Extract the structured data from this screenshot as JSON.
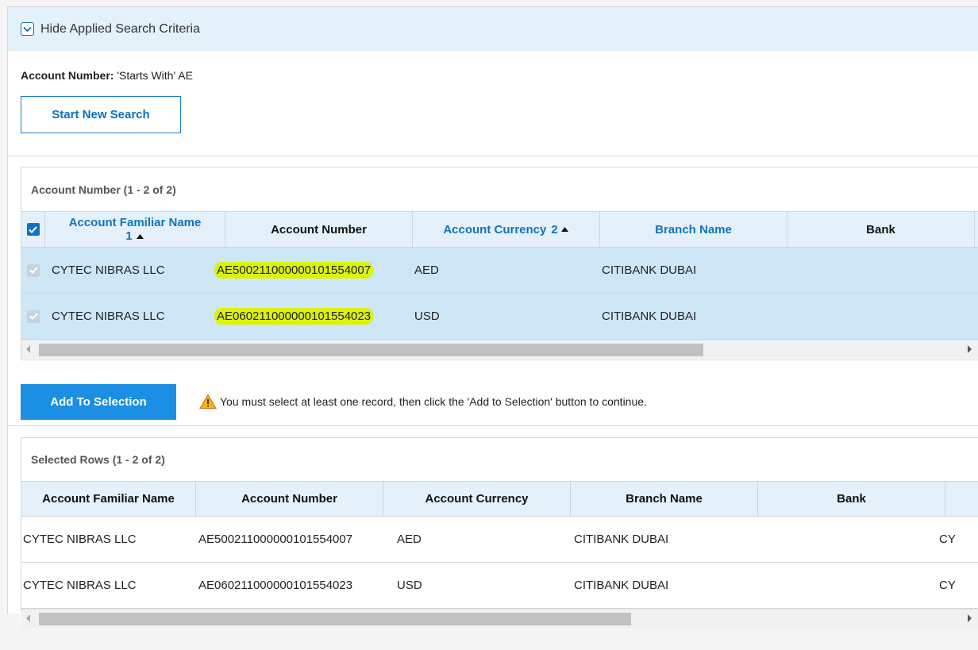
{
  "criteria": {
    "toggle_label": "Hide Applied Search Criteria",
    "field_label": "Account Number:",
    "field_value": "'Starts With' AE",
    "new_search_label": "Start New Search"
  },
  "accounts_grid": {
    "title": "Account Number (1 - 2 of 2)",
    "columns": {
      "familiar_name": "Account Familiar Name",
      "familiar_name_sort": "1",
      "account_number": "Account Number",
      "currency": "Account Currency",
      "currency_sort": "2",
      "branch": "Branch Name",
      "bank": "Bank"
    },
    "rows": [
      {
        "name": "CYTEC NIBRAS LLC",
        "account": "AE500211000000101554007",
        "currency": "AED",
        "branch": "CITIBANK DUBAI"
      },
      {
        "name": "CYTEC NIBRAS LLC",
        "account": "AE060211000000101554023",
        "currency": "USD",
        "branch": "CITIBANK DUBAI"
      }
    ]
  },
  "add_selection": {
    "button_label": "Add To Selection",
    "warning": "You must select at least one record, then click the 'Add to Selection' button to continue."
  },
  "selected_grid": {
    "title": "Selected Rows (1 - 2 of 2)",
    "columns": {
      "familiar_name": "Account Familiar Name",
      "account_number": "Account Number",
      "currency": "Account Currency",
      "branch": "Branch Name",
      "bank": "Bank"
    },
    "rows": [
      {
        "name": "CYTEC NIBRAS LLC",
        "account": "AE500211000000101554007",
        "currency": "AED",
        "branch": "CITIBANK DUBAI",
        "overflow": "CY"
      },
      {
        "name": "CYTEC NIBRAS LLC",
        "account": "AE060211000000101554023",
        "currency": "USD",
        "branch": "CITIBANK DUBAI",
        "overflow": "CY"
      }
    ]
  },
  "icons": {
    "criteria_toggle": "chevron-down-icon",
    "sort": "sort-ascending-icon",
    "warning": "warning-triangle-icon"
  }
}
